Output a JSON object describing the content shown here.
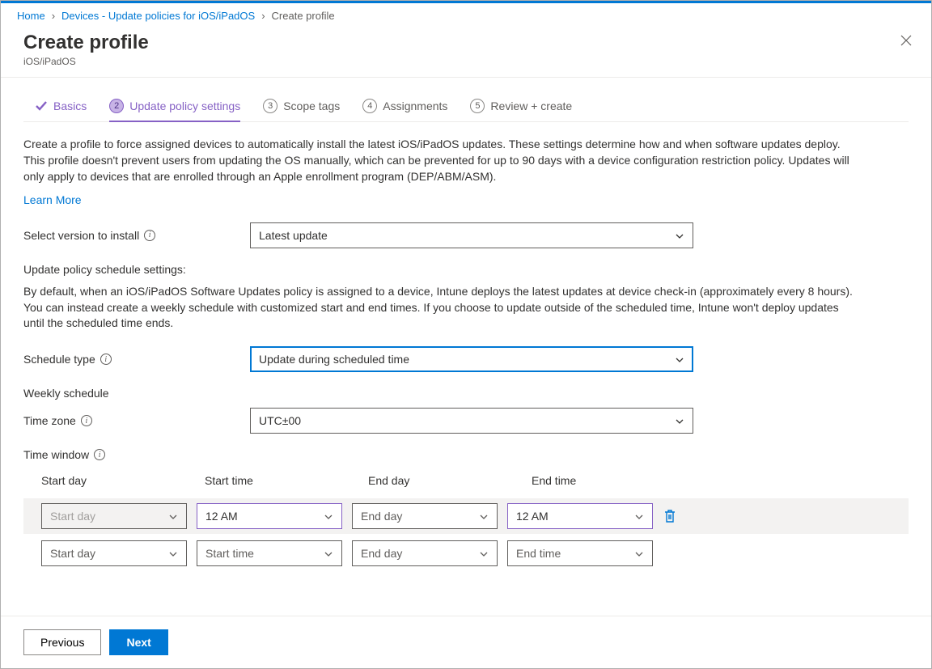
{
  "breadcrumb": {
    "home": "Home",
    "devices": "Devices - Update policies for iOS/iPadOS",
    "current": "Create profile"
  },
  "header": {
    "title": "Create profile",
    "subtitle": "iOS/iPadOS"
  },
  "tabs": {
    "basics": "Basics",
    "update_policy": "Update policy settings",
    "scope_tags": "Scope tags",
    "assignments": "Assignments",
    "review": "Review + create",
    "step2": "2",
    "step3": "3",
    "step4": "4",
    "step5": "5"
  },
  "body": {
    "description": "Create a profile to force assigned devices to automatically install the latest iOS/iPadOS updates. These settings determine how and when software updates deploy. This profile doesn't prevent users from updating the OS manually, which can be prevented for up to 90 days with a device configuration restriction policy. Updates will only apply to devices that are enrolled through an Apple enrollment program (DEP/ABM/ASM).",
    "learn_more": "Learn More",
    "select_version_label": "Select version to install",
    "select_version_value": "Latest update",
    "schedule_settings_head": "Update policy schedule settings:",
    "schedule_para": "By default, when an iOS/iPadOS Software Updates policy is assigned to a device, Intune deploys the latest updates at device check-in (approximately every 8 hours). You can instead create a weekly schedule with customized start and end times. If you choose to update outside of the scheduled time, Intune won't deploy updates until the scheduled time ends.",
    "schedule_type_label": "Schedule type",
    "schedule_type_value": "Update during scheduled time",
    "weekly_schedule_head": "Weekly schedule",
    "timezone_label": "Time zone",
    "timezone_value": "UTC±00",
    "timewindow_label": "Time window"
  },
  "time_window": {
    "headers": {
      "start_day": "Start day",
      "start_time": "Start time",
      "end_day": "End day",
      "end_time": "End time"
    },
    "rows": [
      {
        "start_day": "Start day",
        "start_time": "12 AM",
        "end_day": "End day",
        "end_time": "12 AM",
        "filled": true
      },
      {
        "start_day": "Start day",
        "start_time": "Start time",
        "end_day": "End day",
        "end_time": "End time",
        "filled": false
      }
    ]
  },
  "footer": {
    "previous": "Previous",
    "next": "Next"
  }
}
